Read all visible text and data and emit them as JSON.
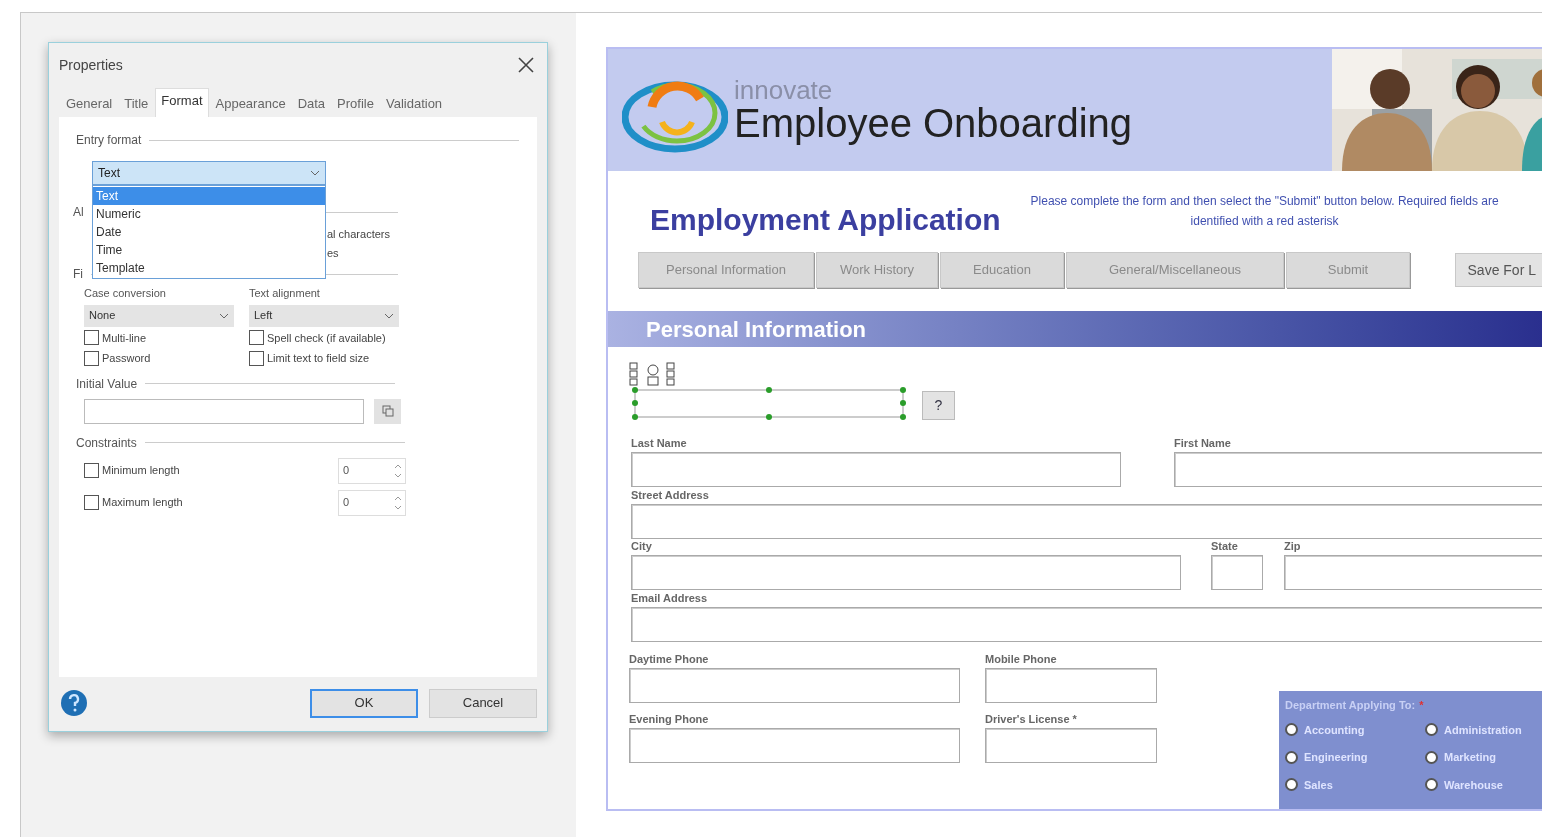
{
  "dialog": {
    "title": "Properties",
    "tabs": [
      {
        "label": "General",
        "selected": false
      },
      {
        "label": "Title",
        "selected": false
      },
      {
        "label": "Format",
        "selected": true
      },
      {
        "label": "Appearance",
        "selected": false
      },
      {
        "label": "Data",
        "selected": false
      },
      {
        "label": "Profile",
        "selected": false
      },
      {
        "label": "Validation",
        "selected": false
      }
    ],
    "entry_format": {
      "label": "Entry format",
      "value": "Text",
      "expanded": true,
      "options": [
        {
          "label": "Text",
          "selected": true
        },
        {
          "label": "Numeric",
          "selected": false
        },
        {
          "label": "Date",
          "selected": false
        },
        {
          "label": "Time",
          "selected": false
        },
        {
          "label": "Template",
          "selected": false
        }
      ]
    },
    "covered_fragments": [
      "Al",
      "al characters",
      "es",
      "Fi"
    ],
    "case_conversion": {
      "label": "Case conversion",
      "value": "None"
    },
    "text_alignment": {
      "label": "Text alignment",
      "value": "Left"
    },
    "checkboxes": [
      {
        "label": "Multi-line",
        "checked": false
      },
      {
        "label": "Spell check (if available)",
        "checked": false
      },
      {
        "label": "Password",
        "checked": false
      },
      {
        "label": "Limit text to field size",
        "checked": false
      }
    ],
    "initial_value": {
      "label": "Initial Value"
    },
    "constraints": {
      "label": "Constraints",
      "items": [
        {
          "label": "Minimum length",
          "checked": false,
          "value": "0"
        },
        {
          "label": "Maximum length",
          "checked": false,
          "value": "0"
        }
      ]
    },
    "buttons": [
      {
        "label": "OK",
        "default": true
      },
      {
        "label": "Cancel",
        "default": false
      }
    ]
  },
  "form": {
    "brand": "innovate",
    "title": "Employee Onboarding",
    "heading": "Employment Application",
    "instructions": "Please complete the form and then select the \"Submit\" button below.  Required fields are identified with a red asterisk",
    "nav_buttons": [
      "Personal Information",
      "Work History",
      "Education",
      "General/Miscellaneous",
      "Submit"
    ],
    "save_button": "Save For L",
    "section": "Personal Information",
    "help_button": "?",
    "rows": [
      [
        {
          "label": "Last Name"
        },
        {
          "label": "First Name"
        }
      ],
      [
        {
          "label": "Street Address"
        }
      ],
      [
        {
          "label": "City"
        },
        {
          "label": "State"
        },
        {
          "label": "Zip"
        }
      ],
      [
        {
          "label": "Email Address"
        }
      ]
    ],
    "phones": [
      [
        {
          "label": "Daytime Phone"
        },
        {
          "label": "Evening Phone"
        }
      ],
      [
        {
          "label": "Mobile Phone"
        },
        {
          "label": "Driver's License *"
        }
      ]
    ],
    "department": {
      "label": "Department Applying To:",
      "required_mark": "*",
      "options": [
        {
          "label": "Accounting",
          "selected": false
        },
        {
          "label": "Administration",
          "selected": false
        },
        {
          "label": "Engineering",
          "selected": false
        },
        {
          "label": "Marketing",
          "selected": false
        },
        {
          "label": "Sales",
          "selected": false
        },
        {
          "label": "Warehouse",
          "selected": false
        }
      ]
    }
  }
}
